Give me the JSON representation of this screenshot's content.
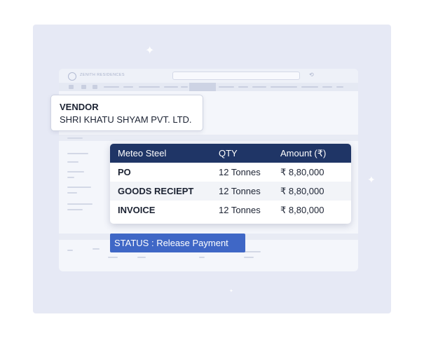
{
  "app": {
    "brand": "ZENITH RESIDENCES",
    "refresh_icon": "refresh-icon",
    "logo_icon": "building-logo-icon",
    "sparkle_icon": "sparkle-icon"
  },
  "vendor": {
    "title": "VENDOR",
    "name": "SHRI KHATU SHYAM PVT. LTD."
  },
  "table": {
    "headers": [
      "Meteo Steel",
      "QTY",
      "Amount (₹)"
    ],
    "rows": [
      {
        "label": "PO",
        "qty": "12 Tonnes",
        "amount": "₹ 8,80,000"
      },
      {
        "label": "GOODS RECIEPT",
        "qty": "12 Tonnes",
        "amount": "₹ 8,80,000"
      },
      {
        "label": "INVOICE",
        "qty": "12 Tonnes",
        "amount": "₹ 8,80,000"
      }
    ]
  },
  "status": {
    "label": "STATUS :  Release Payment"
  },
  "colors": {
    "header_navy": "#1f3566",
    "status_blue": "#3f67c6",
    "panel_bg": "#e6e9f5"
  }
}
